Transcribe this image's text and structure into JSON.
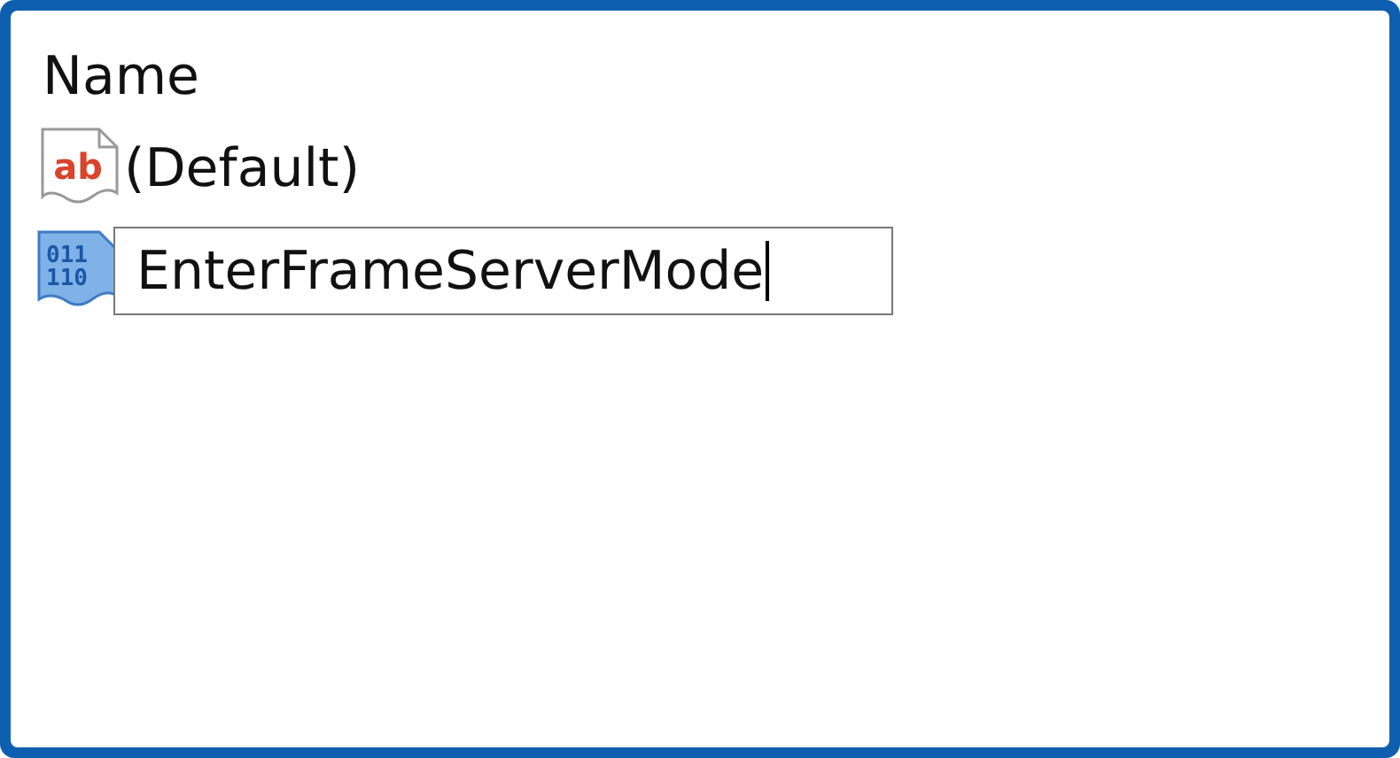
{
  "header": {
    "label": "Name"
  },
  "values": [
    {
      "kind": "string",
      "icon_text": [
        "ab"
      ],
      "name": "(Default)",
      "editing": false
    },
    {
      "kind": "binary",
      "icon_text": [
        "011",
        "110"
      ],
      "name": "EnterFrameServerMode",
      "editing": true
    }
  ]
}
